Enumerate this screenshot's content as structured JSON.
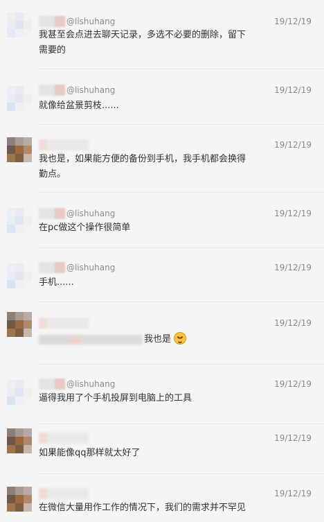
{
  "comments": [
    {
      "handle": "@lishuhang",
      "date": "19/12/19",
      "text": "我甚至会点进去聊天记录，多选不必要的删除，留下\n需要的"
    },
    {
      "handle": "@lishuhang",
      "date": "19/12/19",
      "text": "就像给盆景剪枝......"
    },
    {
      "handle": "",
      "date": "19/12/19",
      "text": "我也是，如果能方便的备份到手机，我手机都会换得\n勤点。"
    },
    {
      "handle": "@lishuhang",
      "date": "19/12/19",
      "text": "在pc做这个操作很简单"
    },
    {
      "handle": "@lishuhang",
      "date": "19/12/19",
      "text": "手机......"
    },
    {
      "handle": "",
      "date": "19/12/19",
      "text": "我也是"
    },
    {
      "handle": "@lishuhang",
      "date": "19/12/19",
      "text": "逼得我用了个手机投屏到电脑上的工具"
    },
    {
      "handle": "",
      "date": "19/12/19",
      "text": "如果能像qq那样就太好了"
    },
    {
      "handle": "",
      "date": "19/12/19",
      "text": "在微信大量用作工作的情况下，我们的需求并不罕见"
    }
  ],
  "colors": {
    "background": "#f5f5f5",
    "text": "#333333",
    "meta": "#8a8a8a",
    "divider": "#e6e6e6"
  },
  "icons": {
    "emoji": "grimacing-face-icon"
  }
}
